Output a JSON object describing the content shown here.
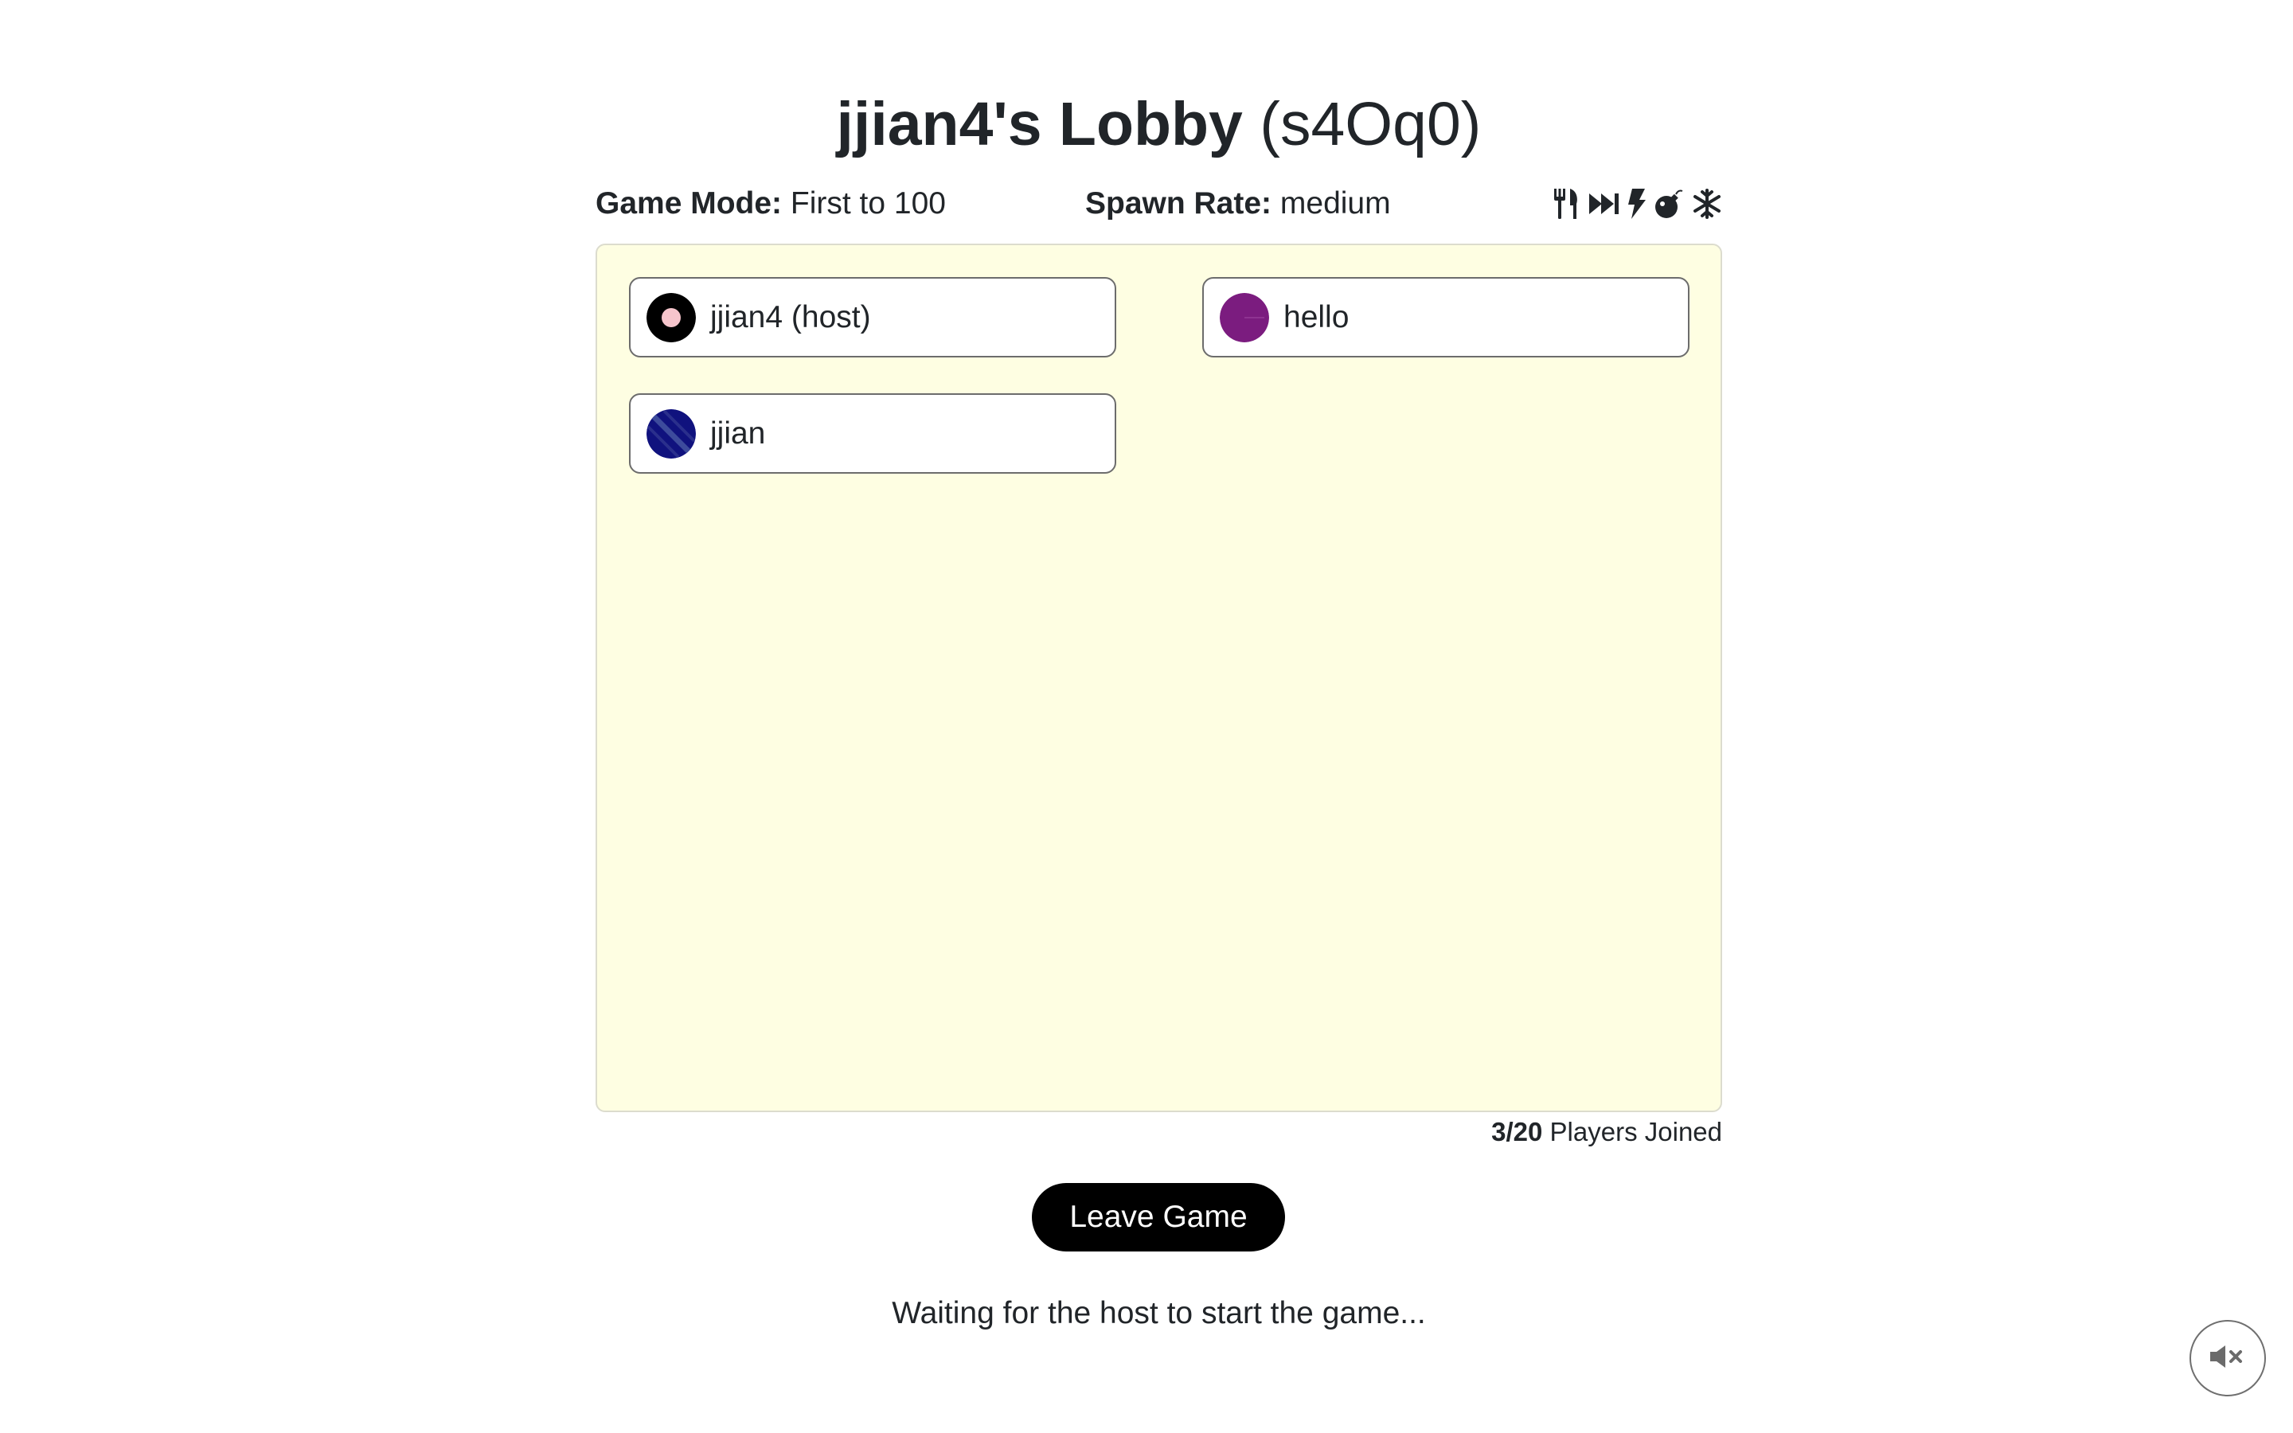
{
  "lobby": {
    "owner_title": "jjian4's Lobby",
    "code": "(s4Oq0)"
  },
  "settings": {
    "game_mode_label": "Game Mode:",
    "game_mode_value": "First to 100",
    "spawn_rate_label": "Spawn Rate:",
    "spawn_rate_value": "medium"
  },
  "powerups": [
    "utensils-icon",
    "fast-forward-icon",
    "bolt-icon",
    "bomb-icon",
    "snowflake-icon"
  ],
  "players": [
    {
      "name": "jjian4 (host)",
      "avatar_colors": {
        "ring": "#000000",
        "center": "#f6c5cc"
      }
    },
    {
      "name": "hello",
      "avatar_colors": {
        "fill": "#7b1c7f"
      }
    },
    {
      "name": "jjian",
      "avatar_colors": {
        "fill": "#10127e",
        "stripe": "#3d4b9c"
      }
    }
  ],
  "players_joined": {
    "count": "3/20",
    "label": "Players Joined"
  },
  "leave_button": "Leave Game",
  "status_text": "Waiting for the host to start the game...",
  "colors": {
    "board_background": "#fefee2",
    "button_background": "#000000"
  },
  "sound_toggle_icon": "volume-mute-icon"
}
